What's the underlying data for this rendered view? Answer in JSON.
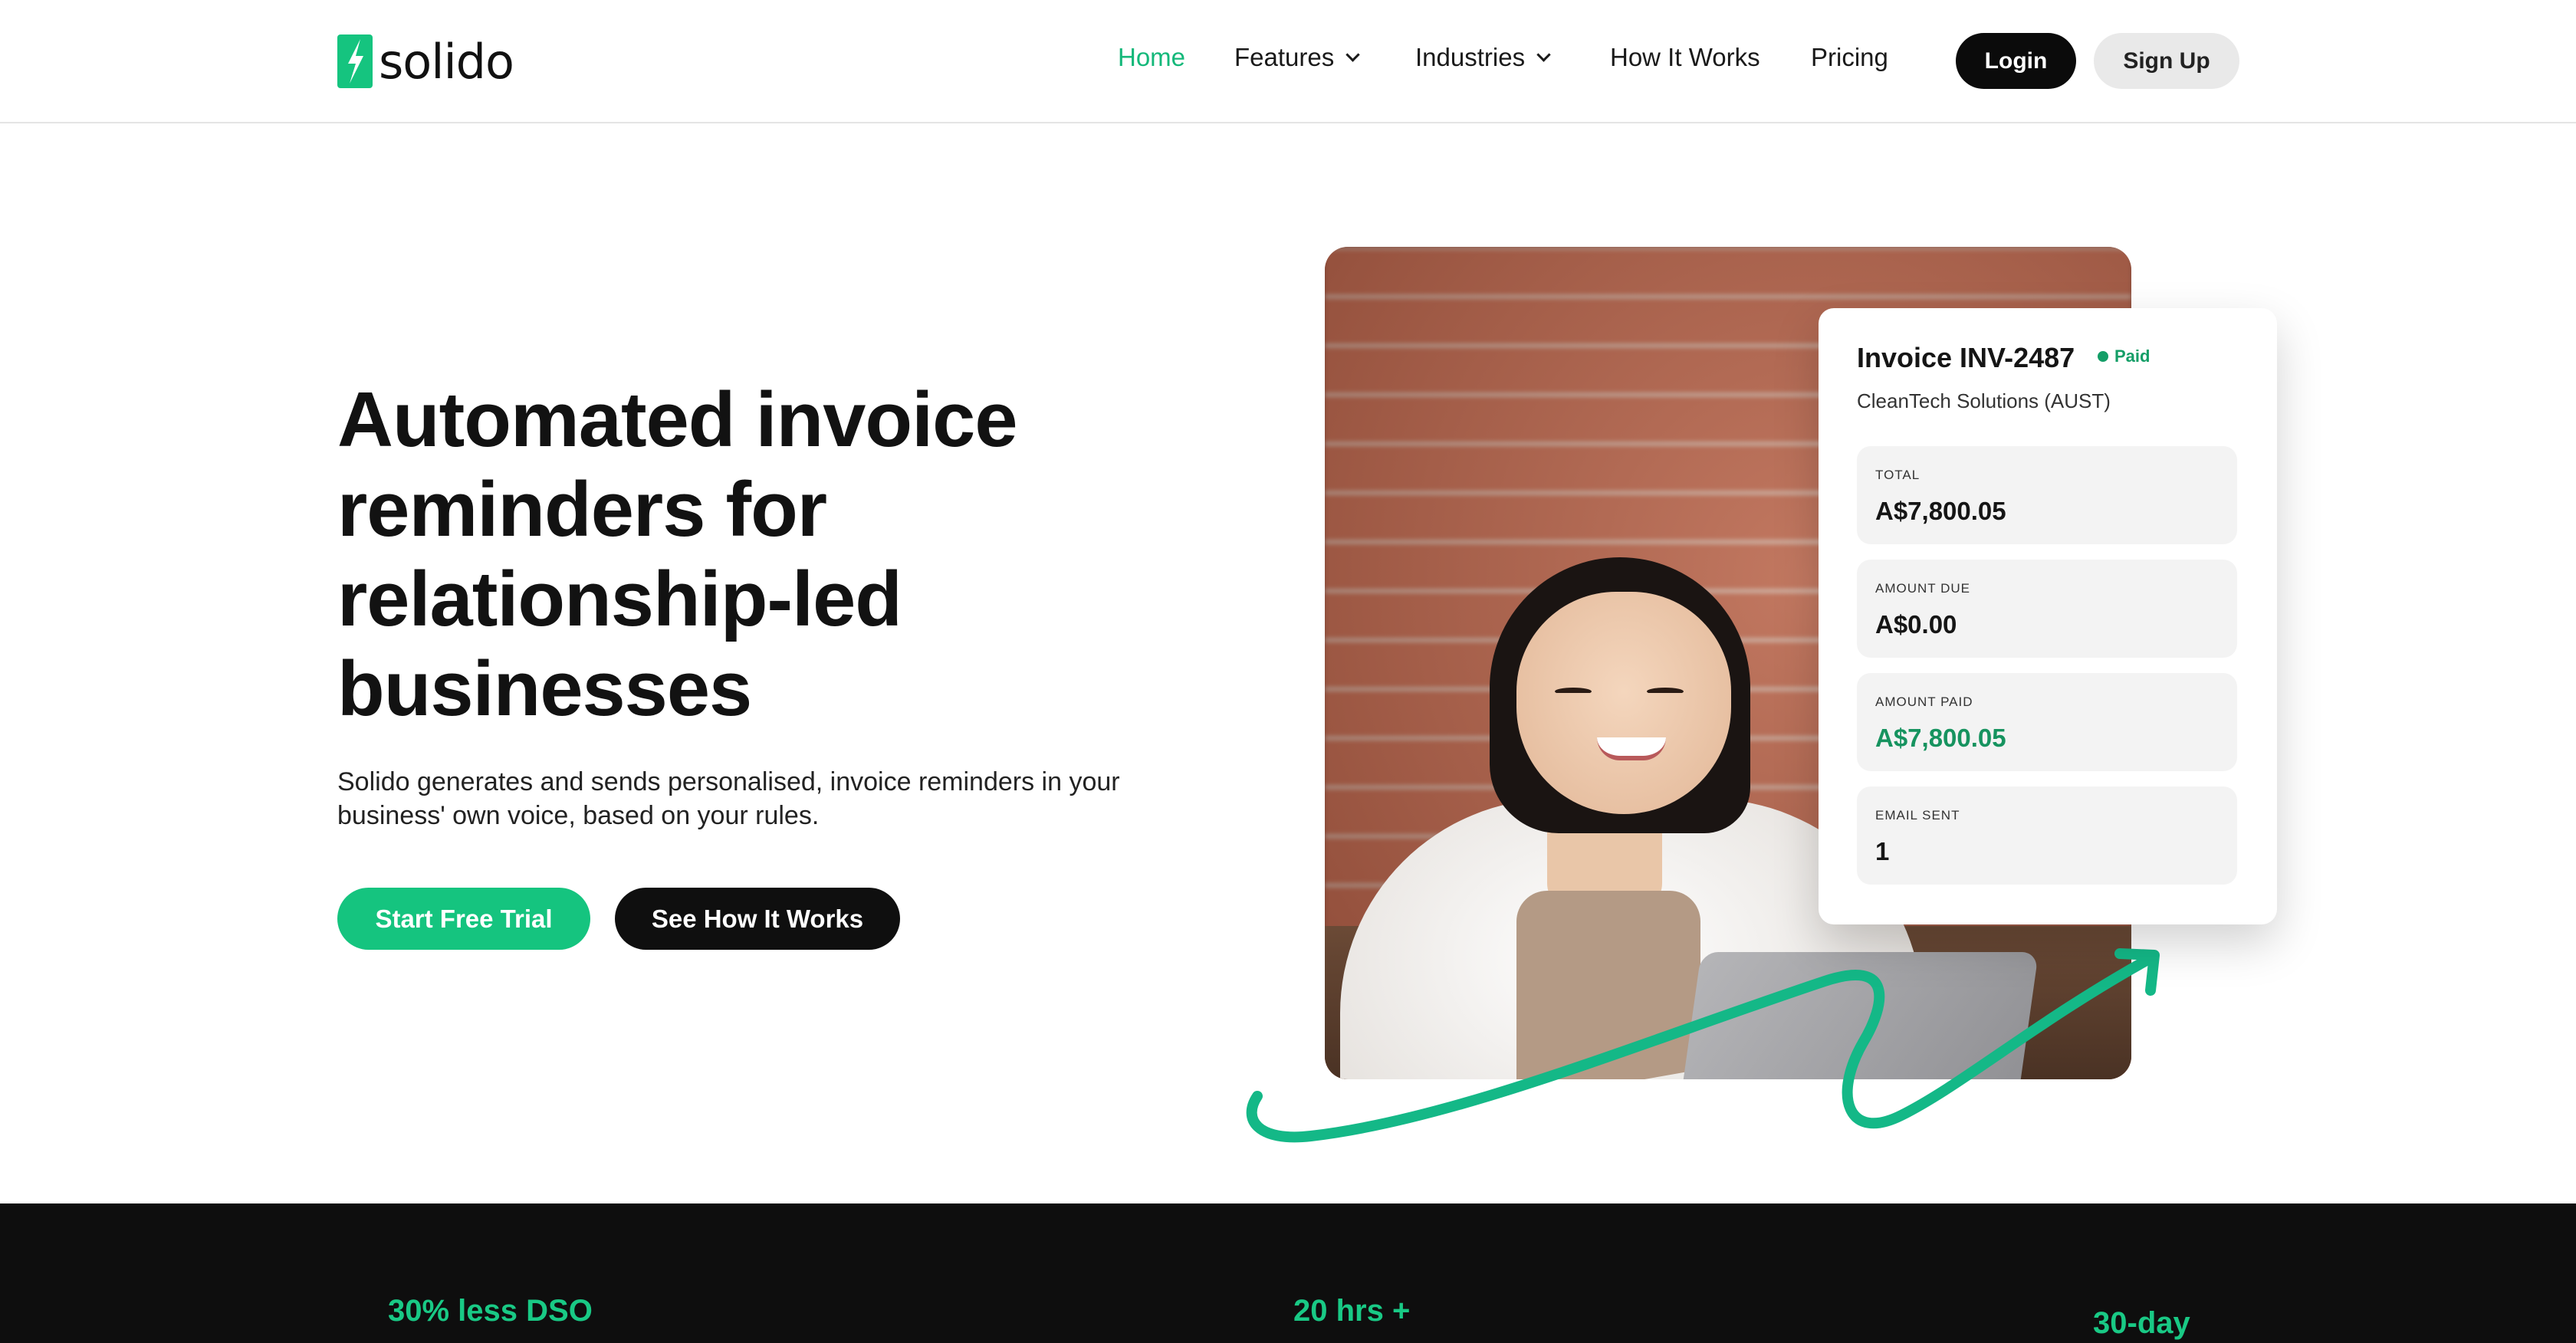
{
  "brand": {
    "name": "solido",
    "accent": "#15c47f"
  },
  "nav": {
    "items": [
      {
        "label": "Home",
        "active": true
      },
      {
        "label": "Features",
        "dropdown": true
      },
      {
        "label": "Industries",
        "dropdown": true
      },
      {
        "label": "How It Works"
      },
      {
        "label": "Pricing"
      }
    ],
    "login_label": "Login",
    "signup_label": "Sign Up"
  },
  "hero": {
    "title": "Automated invoice reminders for relationship-led businesses",
    "description": "Solido generates and sends personalised, invoice reminders in your business' own voice, based on your rules.",
    "primary_cta": "Start Free Trial",
    "secondary_cta": "See How It Works"
  },
  "invoice": {
    "title": "Invoice INV-2487",
    "status": "Paid",
    "client": "CleanTech Solutions (AUST)",
    "stats": [
      {
        "label": "TOTAL",
        "value": "A$7,800.05"
      },
      {
        "label": "AMOUNT DUE",
        "value": "A$0.00"
      },
      {
        "label": "AMOUNT PAID",
        "value": "A$7,800.05"
      },
      {
        "label": "EMAIL SENT",
        "value": "1"
      }
    ]
  },
  "band": {
    "stats": [
      "30% less DSO",
      "20 hrs +",
      "30-day"
    ]
  }
}
